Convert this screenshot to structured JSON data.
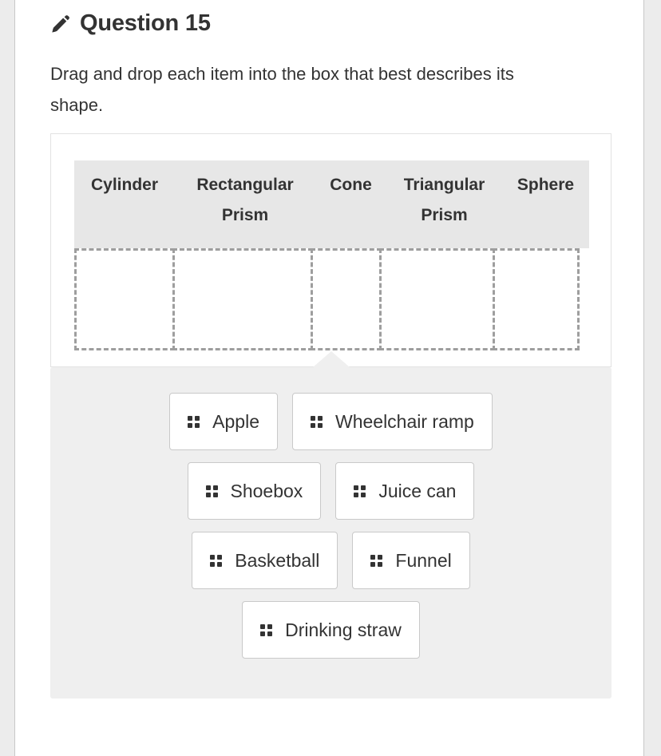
{
  "question": {
    "icon": "pencil-icon",
    "title": "Question 15",
    "prompt": "Drag and drop each item into the box that best describes its shape."
  },
  "drop_area": {
    "categories": [
      {
        "label": "Cylinder"
      },
      {
        "label": "Rectangular Prism"
      },
      {
        "label": "Cone"
      },
      {
        "label": "Triangular Prism"
      },
      {
        "label": "Sphere"
      }
    ],
    "zones": [
      {
        "contents": ""
      },
      {
        "contents": ""
      },
      {
        "contents": ""
      },
      {
        "contents": ""
      },
      {
        "contents": ""
      }
    ]
  },
  "item_bank": {
    "handle_icon": "drag-handle-icon",
    "rows": [
      [
        {
          "label": "Apple"
        },
        {
          "label": "Wheelchair ramp"
        }
      ],
      [
        {
          "label": "Shoebox"
        },
        {
          "label": "Juice can"
        }
      ],
      [
        {
          "label": "Basketball"
        },
        {
          "label": "Funnel"
        }
      ],
      [
        {
          "label": "Drinking straw"
        }
      ]
    ]
  },
  "colors": {
    "text": "#333333",
    "header_band": "#e7e7e7",
    "bank_background": "#efefef",
    "dashed_border": "#9e9e9e",
    "card_border": "#e2e2e2",
    "chip_border": "#c9c9c9",
    "page_gutter": "#ececec"
  }
}
